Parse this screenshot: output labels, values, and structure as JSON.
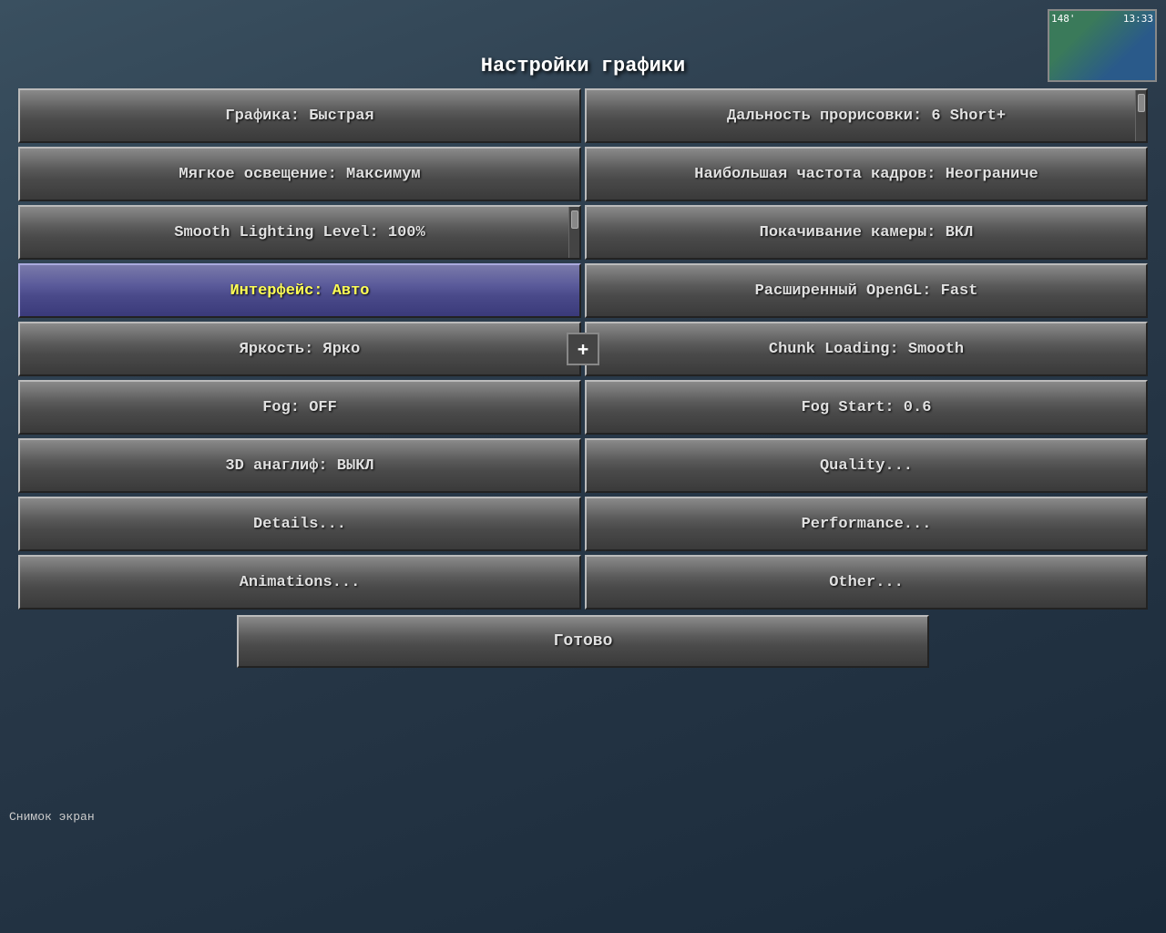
{
  "title": "Настройки графики",
  "minimap": {
    "coords": "148'",
    "time": "13:33"
  },
  "screenshot_label": "Снимок экран",
  "buttons": {
    "left": [
      {
        "id": "graphics",
        "label": "Графика: Быстрая",
        "highlighted": false
      },
      {
        "id": "soft-lighting",
        "label": "Мягкое освещение: Максимум",
        "highlighted": false
      },
      {
        "id": "smooth-lighting-level",
        "label": "Smooth Lighting Level: 100%",
        "highlighted": false
      },
      {
        "id": "interface",
        "label": "Интерфейс: Авто",
        "highlighted": true
      },
      {
        "id": "brightness",
        "label": "Яркость: Ярко",
        "highlighted": false
      },
      {
        "id": "fog",
        "label": "Fog: OFF",
        "highlighted": false
      },
      {
        "id": "anaglyph",
        "label": "3D анаглиф: ВЫКЛ",
        "highlighted": false
      },
      {
        "id": "details",
        "label": "Details...",
        "highlighted": false
      },
      {
        "id": "animations",
        "label": "Animations...",
        "highlighted": false
      }
    ],
    "right": [
      {
        "id": "render-distance",
        "label": "Дальность прорисовки: 6 Short+",
        "highlighted": false
      },
      {
        "id": "max-fps",
        "label": "Наибольшая частота кадров: Неограниче",
        "highlighted": false
      },
      {
        "id": "camera-sway",
        "label": "Покачивание камеры: ВКЛ",
        "highlighted": false
      },
      {
        "id": "opengl",
        "label": "Расширенный OpenGL: Fast",
        "highlighted": false
      },
      {
        "id": "chunk-loading",
        "label": "Chunk Loading: Smooth",
        "highlighted": false
      },
      {
        "id": "fog-start",
        "label": "Fog Start: 0.6",
        "highlighted": false
      },
      {
        "id": "quality",
        "label": "Quality...",
        "highlighted": false
      },
      {
        "id": "performance",
        "label": "Performance...",
        "highlighted": false
      },
      {
        "id": "other",
        "label": "Other...",
        "highlighted": false
      }
    ]
  },
  "done_label": "Готово",
  "plus_label": "+"
}
